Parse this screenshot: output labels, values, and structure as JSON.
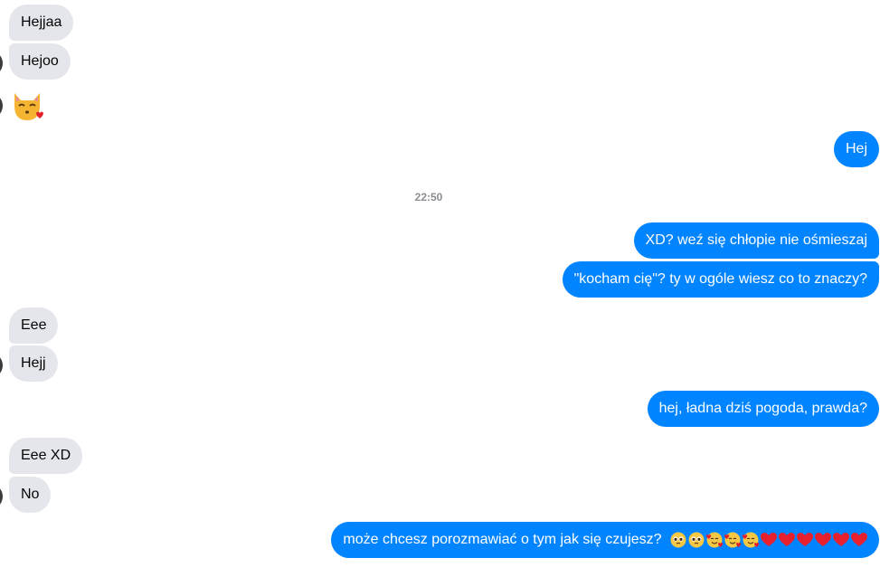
{
  "conversation": {
    "messages": [
      {
        "from": "them",
        "text": "Hejjaa"
      },
      {
        "from": "them",
        "text": "Hejoo"
      },
      {
        "from": "them",
        "emoji": "kissing-cat-emoji"
      },
      {
        "from": "me",
        "text": "Hej"
      },
      {
        "from": "me",
        "text": "XD? weź się chłopie nie ośmieszaj"
      },
      {
        "from": "me",
        "text": "\"kocham cię\"? ty w ogóle wiesz co to znaczy?"
      },
      {
        "from": "them",
        "text": "Eee"
      },
      {
        "from": "them",
        "text": "Hejj"
      },
      {
        "from": "me",
        "text": "hej, ładna dziś pogoda, prawda?"
      },
      {
        "from": "them",
        "text": "Eee XD"
      },
      {
        "from": "them",
        "text": "No"
      },
      {
        "from": "me",
        "text": "może chcesz porozmawiać o tym jak się czujesz?",
        "emojis": [
          "pleading-face-emoji",
          "pleading-face-emoji",
          "smiling-face-with-hearts-emoji",
          "smiling-face-with-hearts-emoji",
          "smiling-face-with-hearts-emoji",
          "red-heart-emoji",
          "red-heart-emoji",
          "red-heart-emoji",
          "red-heart-emoji",
          "red-heart-emoji",
          "red-heart-emoji"
        ]
      }
    ],
    "timestamp": "22:50"
  },
  "colors": {
    "incoming_bubble": "#e4e6eb",
    "outgoing_bubble": "#0084ff",
    "timestamp_text": "#8a8d91"
  }
}
